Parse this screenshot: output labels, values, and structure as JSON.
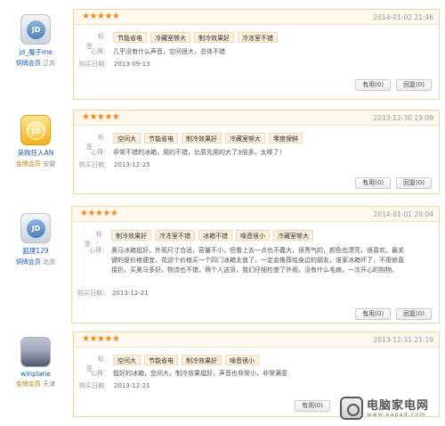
{
  "labels": {
    "tags": "标 签：",
    "comment": "心得：",
    "purchase": "购买日期："
  },
  "reviews": [
    {
      "user": {
        "name": "jd_魔子me",
        "level": "铜牌会员",
        "location": "辽苏",
        "avatar_icon": "jd-default-avatar",
        "avatar_text": "JD"
      },
      "stars": "★★★★★",
      "date": "2014-01-02 21:46",
      "tags": [
        "节能省电",
        "冷藏室够大",
        "制冷效果好",
        "冷冻室不错"
      ],
      "comment": "几乎没有什么声音，空间很大，总体不错",
      "purchase_date": "2013-09-13",
      "useful": "有用(0)",
      "reply": "回复(0)"
    },
    {
      "user": {
        "name": "采购狂人AN",
        "level": "金牌会员",
        "location": "安徽",
        "avatar_icon": "jd-gold-avatar",
        "avatar_text": "JD"
      },
      "stars": "★★★★★",
      "date": "2013-12-30 19:09",
      "tags": [
        "空间大",
        "节能省电",
        "制冷效果好",
        "冷藏室够大",
        "零度保鲜"
      ],
      "comment": "非常不错的冰箱，用的不错，比原先用的大了3倍多，太棒了！",
      "purchase_date": "2013-12-25",
      "useful": "有用(0)",
      "reply": "回复(0)"
    },
    {
      "user": {
        "name": "狐狸129",
        "level": "铜牌会员",
        "location": "北京",
        "avatar_icon": "jd-default-avatar",
        "avatar_text": "JD"
      },
      "stars": "★★★★★",
      "date": "2014-01-01 20:04",
      "tags": [
        "制冷效果好",
        "冷冻室不错",
        "冰箱不错",
        "噪音很小",
        "冷藏室够大"
      ],
      "comment": "奥马冰箱挺好，外观尺寸合适，容量不小，但看上去一点也不蠢大，很秀气的，颜色也漂亮，很喜欢。最关键的是价格便宜，花这个价格买一个四门冰箱太值了，一定会推荐给身边的朋友，谁家冰箱坏了，不用修直接扔，买奥马多好。物流也不错，两个人送货，我们仔细检查了外观，没有什么毛病，一次开心的购物。",
      "purchase_date": "2013-12-21",
      "useful": "有用(0)",
      "reply": "回复(0)"
    },
    {
      "user": {
        "name": "winplane",
        "level": "金牌会员",
        "location": "天津",
        "avatar_icon": "user-photo-avatar",
        "avatar_text": ""
      },
      "stars": "★★★★★",
      "date": "2013-12-31 21:19",
      "tags": [
        "空间大",
        "节能省电",
        "制冷效果好",
        "噪音很小"
      ],
      "comment": "挺好的冰箱，空间大，制冷效果挺好，声音也非常小，非常满意",
      "purchase_date": "2013-12-21",
      "useful": "有用(0)",
      "reply": "回复(0)"
    }
  ],
  "watermark": {
    "title": "电脑家电网",
    "url": "www.eapad.com"
  }
}
